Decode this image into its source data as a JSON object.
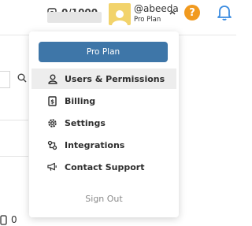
{
  "header": {
    "credits_label": "0/1000",
    "user_name": "@abeeda",
    "user_plan": "Pro Plan",
    "help_label": "?"
  },
  "background": {
    "count_value": "0"
  },
  "menu": {
    "plan_button": "Pro Plan",
    "items": [
      {
        "label": "Users & Permissions",
        "icon": "user-icon",
        "active": true
      },
      {
        "label": "Billing",
        "icon": "billing-icon",
        "active": false
      },
      {
        "label": "Settings",
        "icon": "gear-icon",
        "active": false
      },
      {
        "label": "Integrations",
        "icon": "integrations-icon",
        "active": false
      },
      {
        "label": "Contact Support",
        "icon": "megaphone-icon",
        "active": false
      }
    ],
    "sign_out": "Sign Out"
  },
  "colors": {
    "accent": "#3e76a8",
    "help": "#f19a1f",
    "bell": "#3a8be0",
    "avatar": "#f2d36b"
  }
}
